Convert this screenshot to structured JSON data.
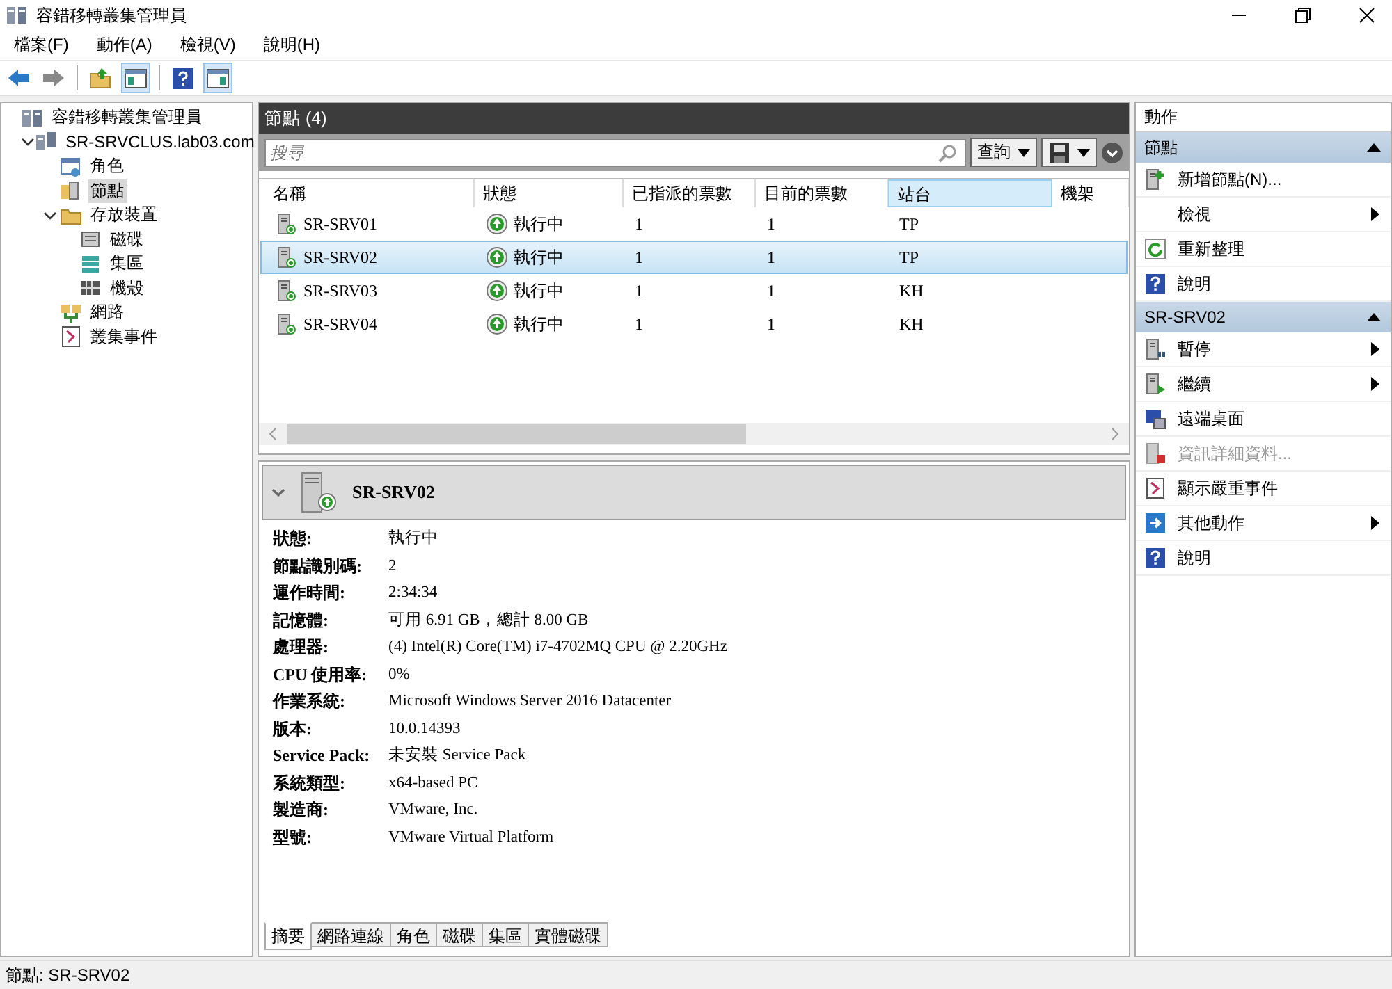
{
  "window": {
    "title": "容錯移轉叢集管理員"
  },
  "menu": [
    "檔案(F)",
    "動作(A)",
    "檢視(V)",
    "說明(H)"
  ],
  "toolbar": [
    [
      {
        "kind": "back",
        "pressed": false
      },
      {
        "kind": "forward",
        "pressed": false
      }
    ],
    [
      {
        "kind": "up",
        "pressed": false
      },
      {
        "kind": "tree",
        "pressed": true
      }
    ],
    [
      {
        "kind": "help",
        "pressed": false
      },
      {
        "kind": "pane",
        "pressed": true
      }
    ]
  ],
  "tree": [
    {
      "label": "容錯移轉叢集管理員",
      "kind": "cluster-manager",
      "selected": false,
      "children": [
        {
          "label": "SR-SRVCLUS.lab03.com",
          "kind": "cluster",
          "selected": false,
          "expanded": true,
          "children": [
            {
              "label": "角色",
              "kind": "roles",
              "selected": false
            },
            {
              "label": "節點",
              "kind": "nodes",
              "selected": true
            },
            {
              "label": "存放裝置",
              "kind": "storage",
              "selected": false,
              "expanded": true,
              "children": [
                {
                  "label": "磁碟",
                  "kind": "disk",
                  "selected": false
                },
                {
                  "label": "集區",
                  "kind": "pool",
                  "selected": false
                },
                {
                  "label": "機殼",
                  "kind": "enclosure",
                  "selected": false
                }
              ]
            },
            {
              "label": "網路",
              "kind": "network",
              "selected": false
            },
            {
              "label": "叢集事件",
              "kind": "events",
              "selected": false
            }
          ]
        }
      ]
    }
  ],
  "nodes_panel": {
    "title": "節點 (4)",
    "search": {
      "placeholder": "搜尋"
    },
    "query_button": "查詢",
    "columns": [
      {
        "label": "名稱",
        "highlighted": false
      },
      {
        "label": "狀態",
        "highlighted": false
      },
      {
        "label": "已指派的票數",
        "highlighted": false
      },
      {
        "label": "目前的票數",
        "highlighted": false
      },
      {
        "label": "站台",
        "highlighted": true
      },
      {
        "label": "機架",
        "highlighted": false
      }
    ],
    "rows": [
      {
        "name": "SR-SRV01",
        "status": "執行中",
        "assigned_votes": "1",
        "current_votes": "1",
        "site": "TP",
        "selected": false
      },
      {
        "name": "SR-SRV02",
        "status": "執行中",
        "assigned_votes": "1",
        "current_votes": "1",
        "site": "TP",
        "selected": true
      },
      {
        "name": "SR-SRV03",
        "status": "執行中",
        "assigned_votes": "1",
        "current_votes": "1",
        "site": "KH",
        "selected": false
      },
      {
        "name": "SR-SRV04",
        "status": "執行中",
        "assigned_votes": "1",
        "current_votes": "1",
        "site": "KH",
        "selected": false
      }
    ]
  },
  "detail": {
    "title": "SR-SRV02",
    "properties": [
      {
        "label": "狀態:",
        "value": "執行中"
      },
      {
        "label": "節點識別碼:",
        "value": "2"
      },
      {
        "label": "運作時間:",
        "value": "2:34:34"
      },
      {
        "label": "記憶體:",
        "value": "可用 6.91 GB，總計 8.00 GB"
      },
      {
        "label": "處理器:",
        "value": "(4) Intel(R) Core(TM) i7-4702MQ CPU @ 2.20GHz"
      },
      {
        "label": "CPU 使用率:",
        "value": "0%"
      },
      {
        "label": "作業系統:",
        "value": "Microsoft Windows Server 2016 Datacenter"
      },
      {
        "label": "版本:",
        "value": "10.0.14393"
      },
      {
        "label": "Service Pack:",
        "value": "未安裝 Service Pack"
      },
      {
        "label": "系統類型:",
        "value": "x64-based PC"
      },
      {
        "label": "製造商:",
        "value": "VMware, Inc."
      },
      {
        "label": "型號:",
        "value": "VMware Virtual Platform"
      }
    ],
    "tabs": [
      {
        "label": "摘要",
        "selected": true
      },
      {
        "label": "網路連線",
        "selected": false
      },
      {
        "label": "角色",
        "selected": false
      },
      {
        "label": "磁碟",
        "selected": false
      },
      {
        "label": "集區",
        "selected": false
      },
      {
        "label": "實體磁碟",
        "selected": false
      }
    ]
  },
  "actions": {
    "title": "動作",
    "sections": [
      {
        "title": "節點",
        "items": [
          {
            "label": "新增節點(N)...",
            "kind": "add-node",
            "disabled": false,
            "submenu": false
          },
          {
            "label": "檢視",
            "kind": "none",
            "disabled": false,
            "submenu": true
          },
          {
            "label": "重新整理",
            "kind": "refresh",
            "disabled": false,
            "submenu": false
          },
          {
            "label": "說明",
            "kind": "help",
            "disabled": false,
            "submenu": false
          }
        ]
      },
      {
        "title": "SR-SRV02",
        "items": [
          {
            "label": "暫停",
            "kind": "pause",
            "disabled": false,
            "submenu": true
          },
          {
            "label": "繼續",
            "kind": "resume",
            "disabled": false,
            "submenu": true
          },
          {
            "label": "遠端桌面",
            "kind": "remote",
            "disabled": false,
            "submenu": false
          },
          {
            "label": "資訊詳細資料...",
            "kind": "info",
            "disabled": true,
            "submenu": false
          },
          {
            "label": "顯示嚴重事件",
            "kind": "events",
            "disabled": false,
            "submenu": false
          },
          {
            "label": "其他動作",
            "kind": "more",
            "disabled": false,
            "submenu": true
          },
          {
            "label": "說明",
            "kind": "help",
            "disabled": false,
            "submenu": false
          }
        ]
      }
    ]
  },
  "status_bar": "節點: SR-SRV02"
}
